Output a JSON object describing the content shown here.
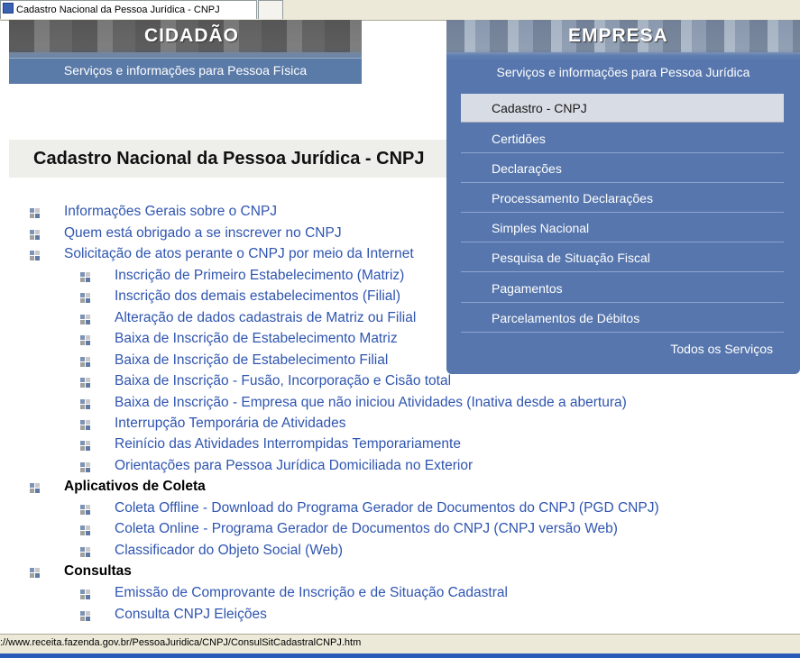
{
  "browser": {
    "tab_title": "Cadastro Nacional da Pessoa Jurídica - CNPJ"
  },
  "banners": {
    "cidadao": {
      "title": "CIDADÃO",
      "subtitle": "Serviços e informações para Pessoa Física"
    },
    "empresa": {
      "title": "EMPRESA",
      "subtitle": "Serviços e informações para Pessoa Jurídica"
    }
  },
  "menu": {
    "items": [
      {
        "label": "Cadastro - CNPJ",
        "active": true
      },
      {
        "label": "Certidões"
      },
      {
        "label": "Declarações"
      },
      {
        "label": "Processamento Declarações"
      },
      {
        "label": "Simples Nacional"
      },
      {
        "label": "Pesquisa de Situação Fiscal"
      },
      {
        "label": "Pagamentos"
      },
      {
        "label": "Parcelamentos de Débitos"
      }
    ],
    "all_services": "Todos os Serviços"
  },
  "page": {
    "title": "Cadastro Nacional da Pessoa Jurídica - CNPJ"
  },
  "links": [
    {
      "text": "Informações Gerais sobre o CNPJ",
      "level": 1,
      "link": true
    },
    {
      "text": "Quem está obrigado a se inscrever no CNPJ",
      "level": 1,
      "link": true
    },
    {
      "text": "Solicitação de atos perante o CNPJ por meio da Internet",
      "level": 1,
      "link": true
    },
    {
      "text": "Inscrição de Primeiro Estabelecimento (Matriz)",
      "level": 2,
      "link": true
    },
    {
      "text": "Inscrição dos demais estabelecimentos (Filial)",
      "level": 2,
      "link": true
    },
    {
      "text": "Alteração de dados cadastrais de Matriz ou Filial",
      "level": 2,
      "link": true
    },
    {
      "text": "Baixa de Inscrição de Estabelecimento Matriz",
      "level": 2,
      "link": true
    },
    {
      "text": "Baixa de Inscrição de Estabelecimento Filial",
      "level": 2,
      "link": true
    },
    {
      "text": "Baixa de Inscrição - Fusão, Incorporação e Cisão total",
      "level": 2,
      "link": true
    },
    {
      "text": "Baixa de Inscrição - Empresa que não iniciou Atividades (Inativa desde a abertura)",
      "level": 2,
      "link": true
    },
    {
      "text": "Interrupção Temporária de Atividades",
      "level": 2,
      "link": true
    },
    {
      "text": "Reinício das Atividades Interrompidas Temporariamente",
      "level": 2,
      "link": true
    },
    {
      "text": "Orientações para Pessoa Jurídica Domiciliada no Exterior",
      "level": 2,
      "link": true
    },
    {
      "text": "Aplicativos de Coleta",
      "level": 1,
      "link": false
    },
    {
      "text": "Coleta Offline - Download do Programa Gerador de Documentos do CNPJ (PGD CNPJ)",
      "level": 2,
      "link": true
    },
    {
      "text": "Coleta Online - Programa Gerador de Documentos do CNPJ (CNPJ versão Web)",
      "level": 2,
      "link": true
    },
    {
      "text": "Classificador do Objeto Social (Web)",
      "level": 2,
      "link": true
    },
    {
      "text": "Consultas",
      "level": 1,
      "link": false
    },
    {
      "text": "Emissão de Comprovante de Inscrição e de Situação Cadastral",
      "level": 2,
      "link": true
    },
    {
      "text": "Consulta CNPJ Eleições",
      "level": 2,
      "link": true
    }
  ],
  "status": {
    "url": "://www.receita.fazenda.gov.br/PessoaJuridica/CNPJ/ConsulSitCadastralCNPJ.htm"
  },
  "colors": {
    "menu_bg": "#5676ad",
    "link": "#2f55b0"
  }
}
